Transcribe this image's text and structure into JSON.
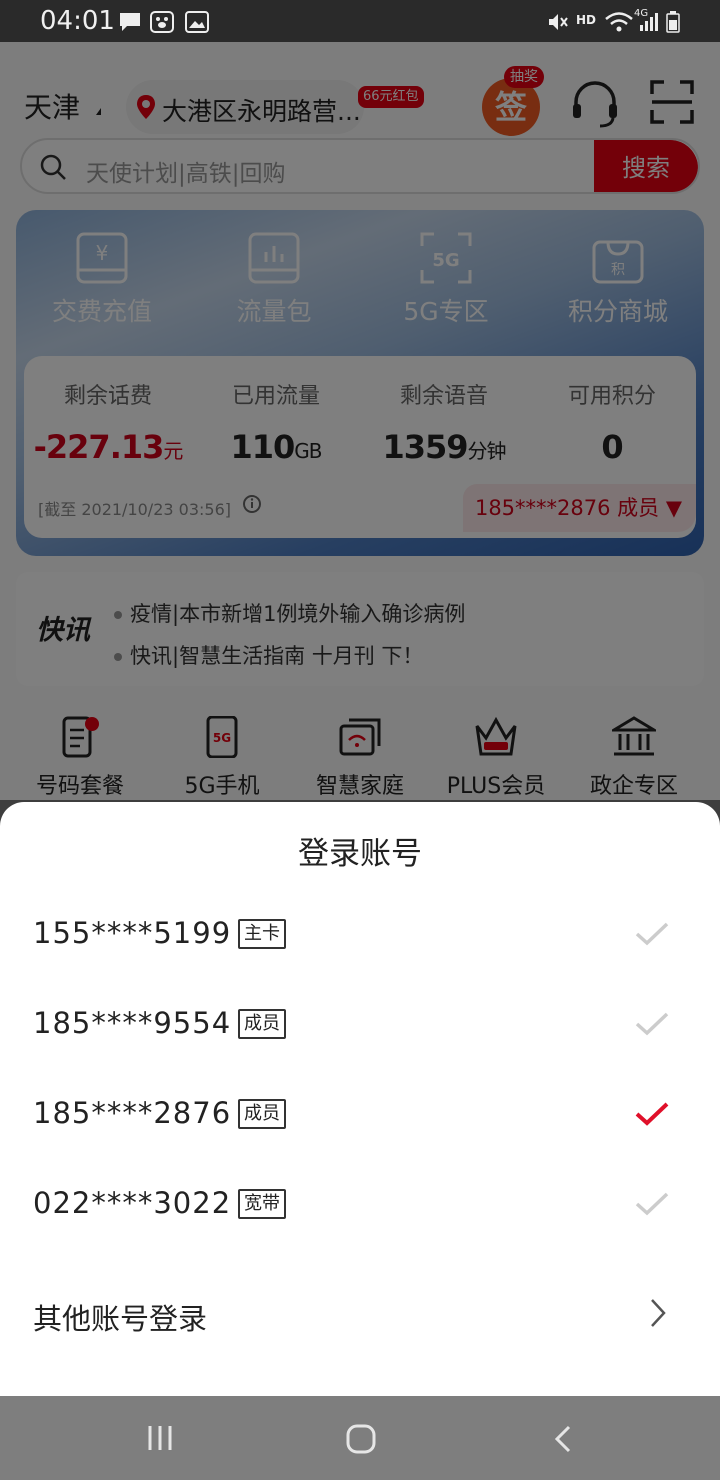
{
  "status_bar": {
    "time": "04:01",
    "network": "4G",
    "hd": "HD"
  },
  "header": {
    "city": "天津",
    "location": "大港区永明路营...",
    "hongbao_badge": "66元红包",
    "sign_label": "签",
    "sign_badge": "抽奖"
  },
  "search": {
    "placeholder": "天使计划|高铁|回购",
    "button": "搜索"
  },
  "shortcuts": [
    {
      "label": "交费充值",
      "icon": "yuan-card-icon"
    },
    {
      "label": "流量包",
      "icon": "data-chart-icon"
    },
    {
      "label": "5G专区",
      "icon": "5g-icon"
    },
    {
      "label": "积分商城",
      "icon": "shopping-bag-icon"
    }
  ],
  "stats": {
    "items": [
      {
        "label": "剩余话费",
        "value": "-227.13",
        "unit": "元"
      },
      {
        "label": "已用流量",
        "value": "110",
        "unit": "GB"
      },
      {
        "label": "剩余语音",
        "value": "1359",
        "unit": "分钟"
      },
      {
        "label": "可用积分",
        "value": "0",
        "unit": ""
      }
    ],
    "as_of": "[截至 2021/10/23 03:56]",
    "current_account": "185****2876 成员"
  },
  "news": {
    "logo": "快讯",
    "items": [
      "疫情|本市新增1例境外输入确诊病例",
      "快讯|智慧生活指南 十月刊 下！"
    ]
  },
  "categories": [
    {
      "label": "号码套餐",
      "icon": "sim-plan-icon"
    },
    {
      "label": "5G手机",
      "icon": "5g-phone-icon"
    },
    {
      "label": "智慧家庭",
      "icon": "smart-home-icon"
    },
    {
      "label": "PLUS会员",
      "icon": "crown-icon"
    },
    {
      "label": "政企专区",
      "icon": "building-icon"
    }
  ],
  "sheet": {
    "title": "登录账号",
    "accounts": [
      {
        "number": "155****5199",
        "tag": "主卡",
        "selected": false
      },
      {
        "number": "185****9554",
        "tag": "成员",
        "selected": false
      },
      {
        "number": "185****2876",
        "tag": "成员",
        "selected": true
      },
      {
        "number": "022****3022",
        "tag": "宽带",
        "selected": false
      }
    ],
    "other_login": "其他账号登录"
  },
  "colors": {
    "brand_red": "#e60012",
    "check_active": "#e0102a",
    "check_inactive": "#cccccc"
  }
}
